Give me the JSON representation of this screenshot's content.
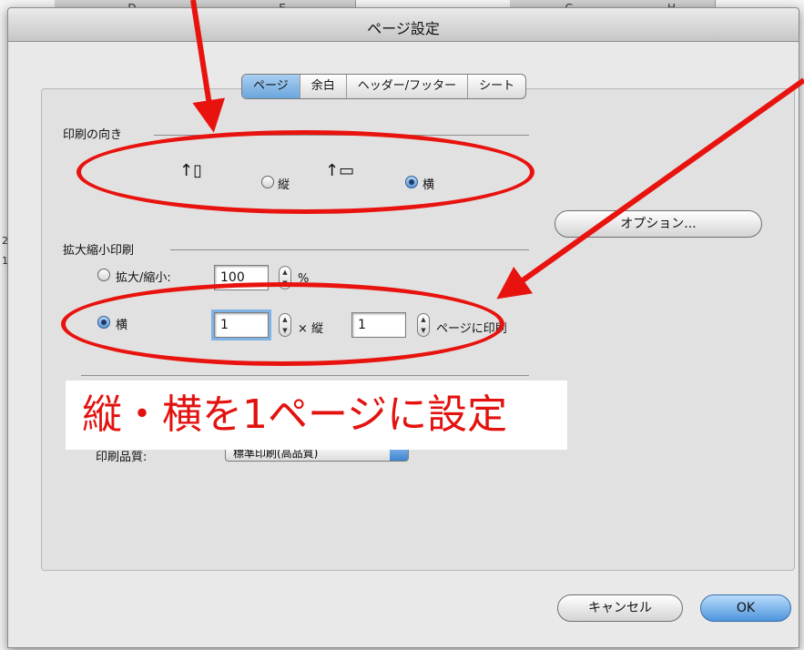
{
  "spreadsheet": {
    "columns": [
      "D",
      "E",
      "G",
      "H"
    ],
    "rows": [
      "2",
      "1"
    ]
  },
  "dialog": {
    "title": "ページ設定",
    "tabs": [
      "ページ",
      "余白",
      "ヘッダー/フッター",
      "シート"
    ],
    "active_tab": "ページ",
    "orientation": {
      "section_label": "印刷の向き",
      "portrait_label": "縦",
      "landscape_label": "横",
      "selected": "横"
    },
    "scaling": {
      "section_label": "拡大縮小印刷",
      "zoom_label": "拡大/縮小:",
      "zoom_value": "100",
      "zoom_unit": "%",
      "fit_label": "横",
      "fit_width_value": "1",
      "times_label": "× 縦",
      "fit_height_value": "1",
      "pages_suffix": "ページに印刷",
      "selected": "横"
    },
    "quality": {
      "label": "印刷品質:",
      "value": "標準印刷(高品質)"
    },
    "options_button": "オプション...",
    "cancel_button": "キャンセル",
    "ok_button": "OK"
  },
  "annotation": {
    "callout_text": "縦・横を1ページに設定",
    "color": "#e8130f"
  }
}
